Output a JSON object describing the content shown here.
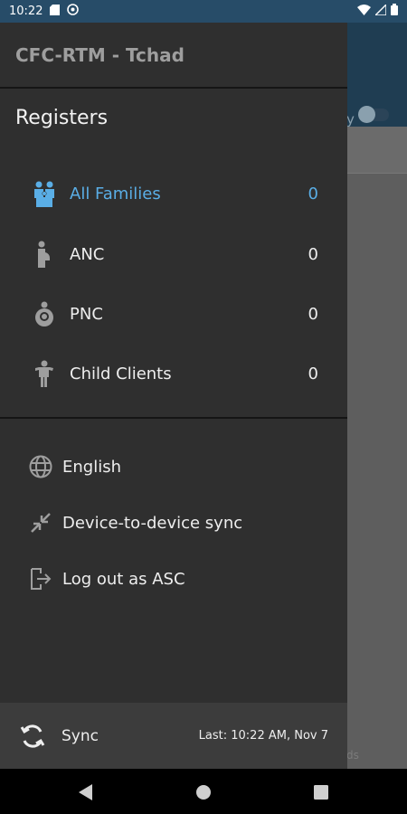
{
  "status_bar": {
    "time": "10:22"
  },
  "drawer": {
    "app_title": "CFC-RTM - Tchad",
    "registers_title": "Registers",
    "registers": [
      {
        "label": "All Families",
        "count": "0",
        "icon": "families-icon"
      },
      {
        "label": "ANC",
        "count": "0",
        "icon": "pregnant-woman-icon"
      },
      {
        "label": "PNC",
        "count": "0",
        "icon": "mother-child-icon"
      },
      {
        "label": "Child Clients",
        "count": "0",
        "icon": "child-icon"
      }
    ],
    "options": [
      {
        "label": "English",
        "icon": "globe-icon"
      },
      {
        "label": "Device-to-device sync",
        "icon": "swap-arrows-icon"
      },
      {
        "label": "Log out as ASC",
        "icon": "logout-icon"
      }
    ],
    "sync": {
      "label": "Sync",
      "last": "Last: 10:22 AM, Nov 7",
      "icon": "sync-icon"
    }
  },
  "background": {
    "partial_text_top": "y",
    "partial_text_bottom": "ds"
  },
  "colors": {
    "accent": "#5aaee6",
    "drawer_bg": "#2f2f2f",
    "status_bar": "#274c68"
  }
}
